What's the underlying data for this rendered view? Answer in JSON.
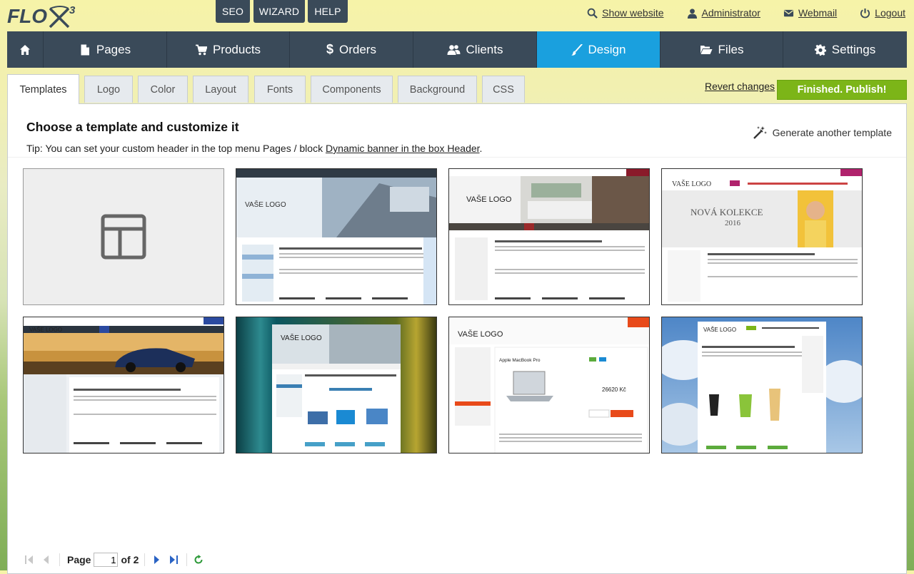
{
  "brand": {
    "name": "FLOX",
    "superscript": "3"
  },
  "top_buttons": [
    "SEO",
    "WIZARD",
    "HELP"
  ],
  "top_links": {
    "show_website": "Show website",
    "administrator": "Administrator",
    "webmail": "Webmail",
    "logout": "Logout"
  },
  "nav": {
    "pages": "Pages",
    "products": "Products",
    "orders": "Orders",
    "clients": "Clients",
    "design": "Design",
    "files": "Files",
    "settings": "Settings",
    "active": "Design"
  },
  "subtabs": [
    "Templates",
    "Logo",
    "Color",
    "Layout",
    "Fonts",
    "Components",
    "Background",
    "CSS"
  ],
  "subtab_active": "Templates",
  "actions": {
    "revert": "Revert changes",
    "publish": "Finished. Publish!"
  },
  "panel": {
    "title": "Choose a template and customize it",
    "tip_prefix": "Tip: You can set your custom header in the top menu Pages / block ",
    "tip_link": "Dynamic banner in the box Header",
    "tip_suffix": ".",
    "generate": "Generate another template"
  },
  "templates": {
    "logo_text": "VAŠE LOGO",
    "collection_heading": "NOVÁ KOLEKCE",
    "collection_year": "2016",
    "product_title": "Apple MacBook Pro",
    "price": "26620 Kč"
  },
  "pager": {
    "page_label": "Page",
    "current": "1",
    "of_label": "of 2"
  },
  "colors": {
    "nav": "#3a4a59",
    "active": "#1aa0de",
    "publish": "#7cb518"
  }
}
